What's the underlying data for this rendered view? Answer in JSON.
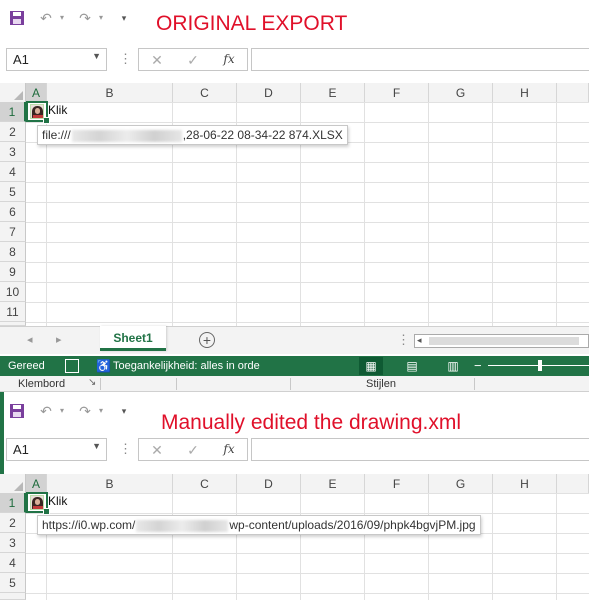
{
  "top_window": {
    "overlay_label": "ORIGINAL EXPORT",
    "namebox": "A1",
    "formula_icons": [
      "cancel-icon",
      "enter-icon",
      "fx-icon"
    ],
    "fx_label": "fx",
    "columns": [
      "A",
      "B",
      "C",
      "D",
      "E",
      "F",
      "G",
      "H"
    ],
    "rows": [
      "1",
      "2",
      "3",
      "4",
      "5",
      "6",
      "7",
      "8",
      "9",
      "10",
      "11"
    ],
    "cell_a1_text": "Klik",
    "tooltip_prefix": "file:///",
    "tooltip_suffix": ",28-06-22 08-34-22 874.XLSX"
  },
  "sheet_tabs": {
    "active": "Sheet1",
    "add": "+"
  },
  "status_bar": {
    "ready": "Gereed",
    "accessibility": "Toegankelijkheid: alles in orde",
    "zoom_minus": "−"
  },
  "ribbon_groups": {
    "clipboard": "Klembord",
    "styles": "Stijlen"
  },
  "bottom_window": {
    "overlay_label": "Manually edited the drawing.xml",
    "namebox": "A1",
    "fx_label": "fx",
    "columns": [
      "A",
      "B",
      "C",
      "D",
      "E",
      "F",
      "G",
      "H"
    ],
    "rows": [
      "1",
      "2",
      "3",
      "4",
      "5"
    ],
    "cell_a1_text": "Klik",
    "tooltip_prefix": "https://i0.wp.com/",
    "tooltip_suffix": "wp-content/uploads/2016/09/phpk4bgvjPM.jpg"
  },
  "colors": {
    "excel_green": "#217346",
    "overlay_red": "#e0102a"
  }
}
